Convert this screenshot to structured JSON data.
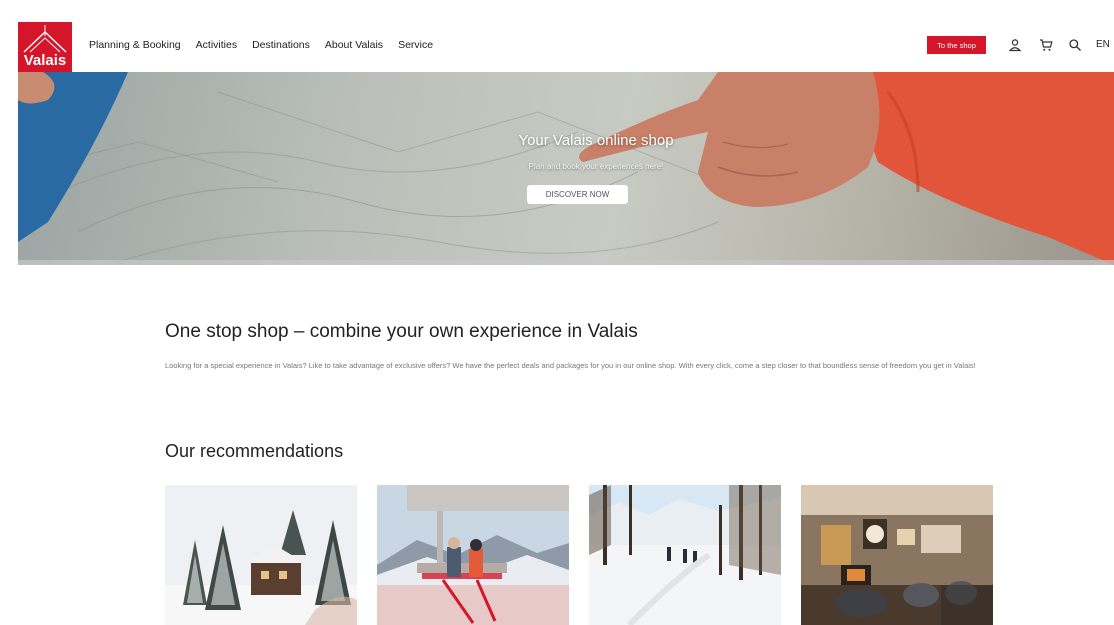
{
  "header": {
    "logo_text": "Valais",
    "nav": [
      "Planning & Booking",
      "Activities",
      "Destinations",
      "About Valais",
      "Service"
    ],
    "shop_button": "To the shop",
    "language": "EN",
    "icons": [
      "user-icon",
      "cart-icon",
      "search-icon"
    ]
  },
  "hero": {
    "title": "Your Valais online shop",
    "subtitle": "Plan and book your experiences here!",
    "button": "DISCOVER NOW"
  },
  "intro": {
    "title": "One stop shop – combine your own experience in Valais",
    "text": "Looking for a special experience in Valais? Like to take advantage of exclusive offers? We have the perfect deals and packages for you in our online shop. With every click, come a step closer to that boundless sense of freedom you get in Valais!"
  },
  "recommendations": {
    "title": "Our recommendations",
    "cards": [
      "snowy-chalet-image",
      "chairlift-skiers-image",
      "ski-trail-image",
      "lounge-interior-image"
    ]
  },
  "colors": {
    "brand_red": "#d5162a",
    "text_dark": "#222222",
    "text_muted": "#777777"
  }
}
